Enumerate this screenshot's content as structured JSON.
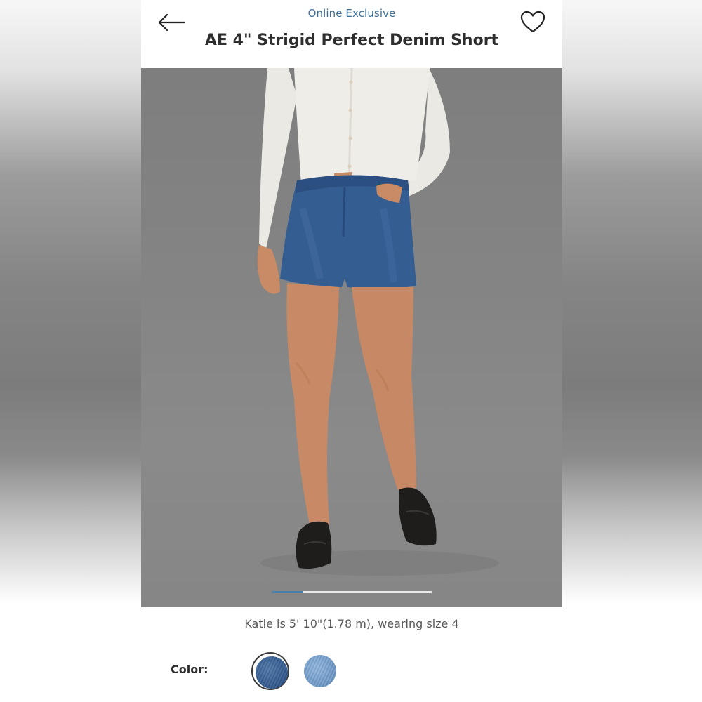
{
  "header": {
    "eyebrow": "Online Exclusive",
    "title": "AE 4\" Strigid Perfect Denim Short",
    "back_icon": "arrow-left-icon",
    "favorite_icon": "heart-outline-icon"
  },
  "gallery": {
    "image_alt": "Model wearing denim shorts with white cardigan and black loafers",
    "current_image": 1,
    "total_images": 5
  },
  "model_info": "Katie is 5' 10\"(1.78 m), wearing size 4",
  "color": {
    "label": "Color:",
    "swatches": [
      {
        "name": "dark wash",
        "hex": "#335b8f",
        "selected": true
      },
      {
        "name": "light wash",
        "hex": "#6d98c6",
        "selected": false
      }
    ]
  },
  "colors": {
    "accent": "#3f6f96",
    "title_text": "#2e2e2e",
    "pager_active": "#4a7fa8"
  }
}
